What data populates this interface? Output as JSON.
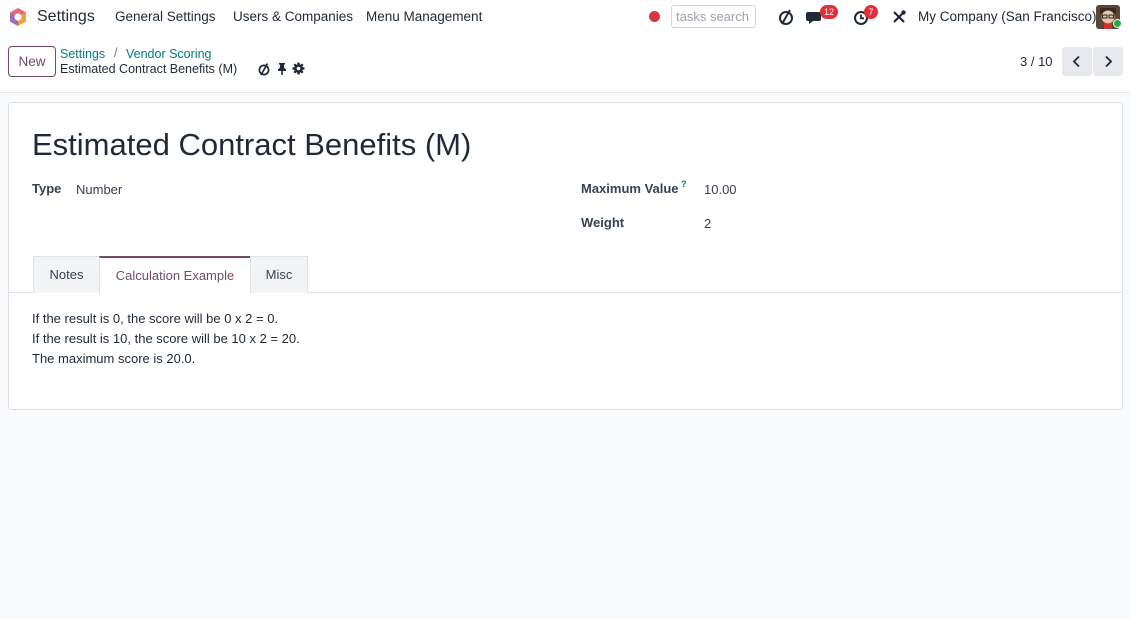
{
  "navbar": {
    "app_name": "Settings",
    "menu": [
      "General Settings",
      "Users & Companies",
      "Menu Management"
    ],
    "search_placeholder": "tasks search",
    "messages_count": "12",
    "activities_count": "7",
    "company": "My Company (San Francisco)",
    "colors": {
      "recording": "#dc3545",
      "badge": "#e0303a",
      "online": "#28a745"
    }
  },
  "control": {
    "new_label": "New",
    "breadcrumb": [
      "Settings",
      "Vendor Scoring"
    ],
    "breadcrumb_sep": "/",
    "current": "Estimated Contract Benefits (M)",
    "pager": "3 / 10"
  },
  "record": {
    "title": "Estimated Contract Benefits (M)",
    "type_label": "Type",
    "type_value": "Number",
    "max_label": "Maximum Value",
    "max_help": "?",
    "max_value": "10.00",
    "weight_label": "Weight",
    "weight_value": "2"
  },
  "tabs": [
    {
      "label": "Notes",
      "active": false
    },
    {
      "label": "Calculation Example",
      "active": true
    },
    {
      "label": "Misc",
      "active": false
    }
  ],
  "calculation_example": [
    "If the result is 0, the score will be 0 x 2 = 0.",
    "If the result is 10, the score will be 10 x 2 = 20.",
    "The maximum score is 20.0."
  ],
  "theme": {
    "primary": "#714b67",
    "link": "#017e84"
  }
}
